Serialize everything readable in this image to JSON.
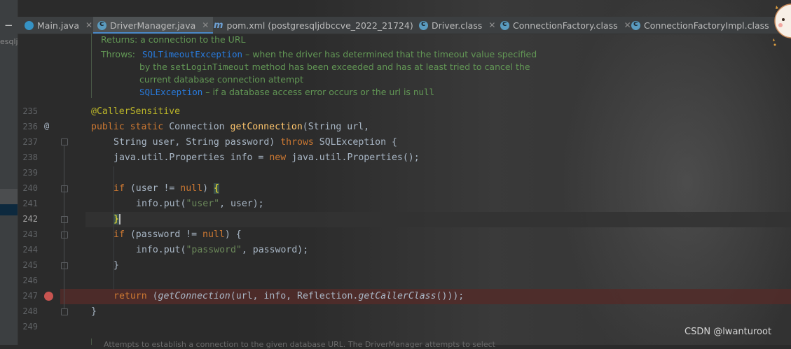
{
  "tabs": [
    {
      "label": "Main.java",
      "icon": "java-class-icon",
      "active": false
    },
    {
      "label": "DriverManager.java",
      "icon": "java-class-icon",
      "active": true
    },
    {
      "label": "pom.xml (postgresqljdbccve_2022_21724)",
      "icon": "maven-icon",
      "active": false
    },
    {
      "label": "Driver.class",
      "icon": "class-file-icon",
      "active": false
    },
    {
      "label": "ConnectionFactory.class",
      "icon": "class-file-icon",
      "active": false
    },
    {
      "label": "ConnectionFactoryImpl.class",
      "icon": "class-file-icon",
      "active": false
    }
  ],
  "sidebar": {
    "collapse_symbol": "−",
    "project_fragment": "esqlj"
  },
  "doc": {
    "returns": "Returns: a connection to the URL",
    "throws_label": "Throws:",
    "ex1_name": "SQLTimeoutException",
    "ex1_desc_a": " – when the driver has determined that the timeout value specified",
    "ex1_desc_b_prefix": "by the ",
    "ex1_desc_b_code": "setLoginTimeout",
    "ex1_desc_b_suffix": " method has been exceeded and has at least tried to cancel the",
    "ex1_desc_c": "current database connection attempt",
    "ex2_name": "SQLException",
    "ex2_desc": " – if a database access error occurs or the url is ",
    "ex2_code": "null"
  },
  "lines": {
    "n235": "235",
    "n236": "236",
    "n237": "237",
    "n238": "238",
    "n239": "239",
    "n240": "240",
    "n241": "241",
    "n242": "242",
    "n243": "243",
    "n244": "244",
    "n245": "245",
    "n246": "246",
    "n247": "247",
    "n248": "248",
    "n249": "249"
  },
  "code": {
    "ann": "@CallerSensitive",
    "public": "public",
    "static": "static",
    "type_conn": "Connection",
    "getConnection": "getConnection",
    "sig1_rest": "(String url,",
    "sig2_a": "String user, String password) ",
    "throws": "throws",
    "sig2_b": " SQLException {",
    "l238_a": "java.util.Properties info = ",
    "new": "new",
    "l238_b": " java.util.Properties();",
    "if": "if",
    "l240_a": " (user != ",
    "null": "null",
    "l240_b": ") ",
    "open_brace": "{",
    "l241_a": "info.put(",
    "l241_str": "\"user\"",
    "l241_b": ", user);",
    "close_brace": "}",
    "l243_a": " (password != ",
    "l243_b": ") {",
    "l244_a": "info.put(",
    "l244_str": "\"password\"",
    "l244_b": ", password);",
    "return": "return",
    "l247_a": " (",
    "l247_fn1": "getConnection",
    "l247_b": "(url, info, Reflection.",
    "l247_fn2": "getCallerClass",
    "l247_c": "()));",
    "at_symbol": "@"
  },
  "bottom_doc_fragment": "Attempts to establish a connection to the given database URL. The DriverManager attempts to select",
  "watermark": "CSDN @lwanturoot",
  "colors": {
    "keyword": "#cc7832",
    "annotation": "#bbb529",
    "function": "#ffc66d",
    "string": "#6a8759",
    "doc": "#629755",
    "doc_link": "#287bde",
    "breakpoint": "#c75450"
  }
}
